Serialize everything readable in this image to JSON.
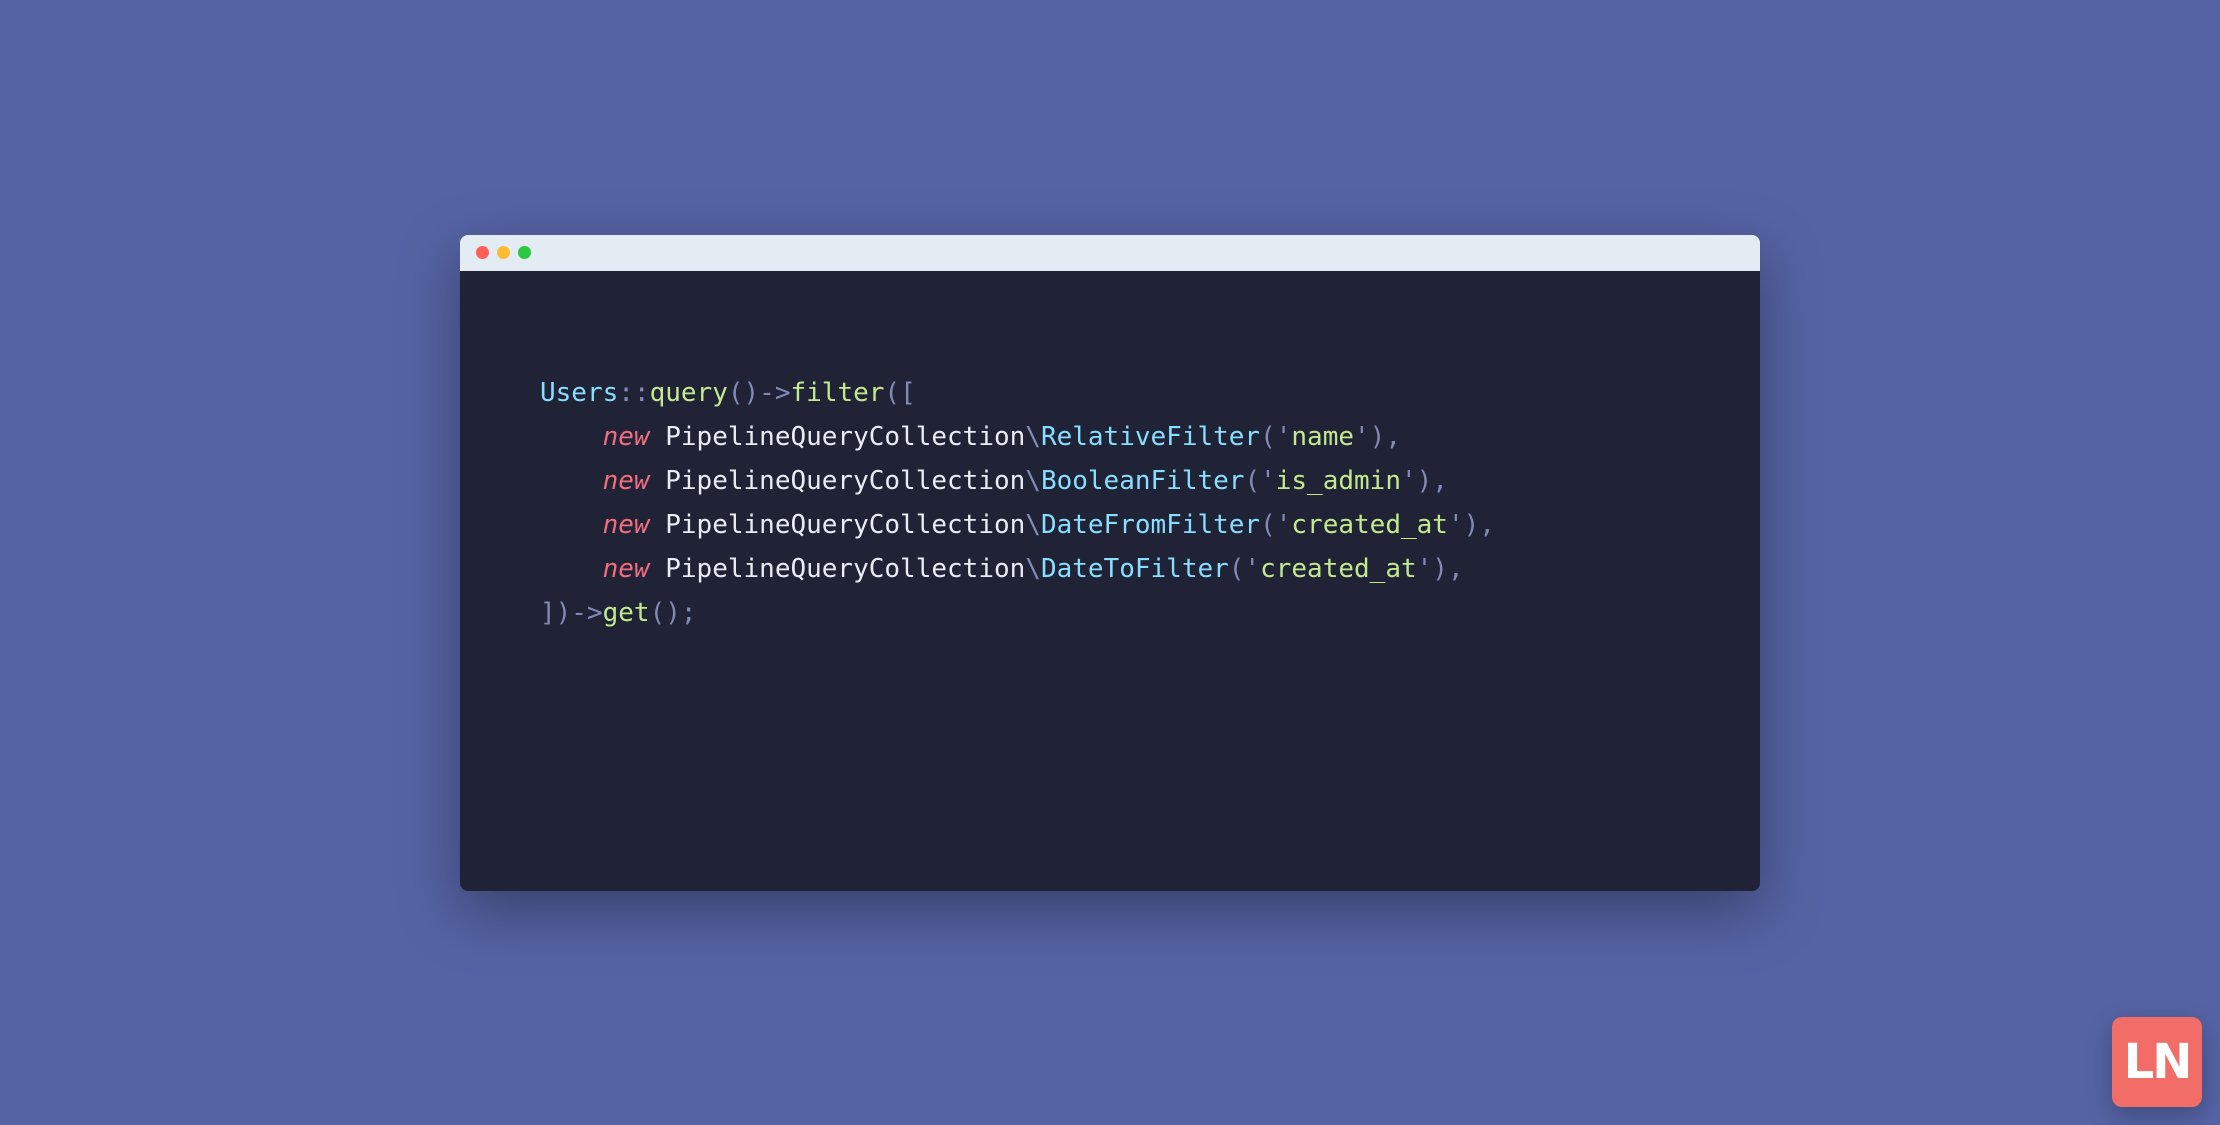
{
  "code": {
    "line1": {
      "class": "Users",
      "scope": "::",
      "fn1": "query",
      "p1": "()->",
      "fn2": "filter",
      "p2": "(["
    },
    "filters": [
      {
        "indent": "    ",
        "kw": "new",
        "sp": " ",
        "ns": "PipelineQueryCollection",
        "bs": "\\",
        "type": "RelativeFilter",
        "open": "('",
        "arg": "name",
        "close": "'),"
      },
      {
        "indent": "    ",
        "kw": "new",
        "sp": " ",
        "ns": "PipelineQueryCollection",
        "bs": "\\",
        "type": "BooleanFilter",
        "open": "('",
        "arg": "is_admin",
        "close": "'),"
      },
      {
        "indent": "    ",
        "kw": "new",
        "sp": " ",
        "ns": "PipelineQueryCollection",
        "bs": "\\",
        "type": "DateFromFilter",
        "open": "('",
        "arg": "created_at",
        "close": "'),"
      },
      {
        "indent": "    ",
        "kw": "new",
        "sp": " ",
        "ns": "PipelineQueryCollection",
        "bs": "\\",
        "type": "DateToFilter",
        "open": "('",
        "arg": "created_at",
        "close": "'),"
      }
    ],
    "lineEnd": {
      "close": "])->",
      "fn": "get",
      "tail": "();"
    }
  },
  "logo": {
    "text": "LN"
  }
}
